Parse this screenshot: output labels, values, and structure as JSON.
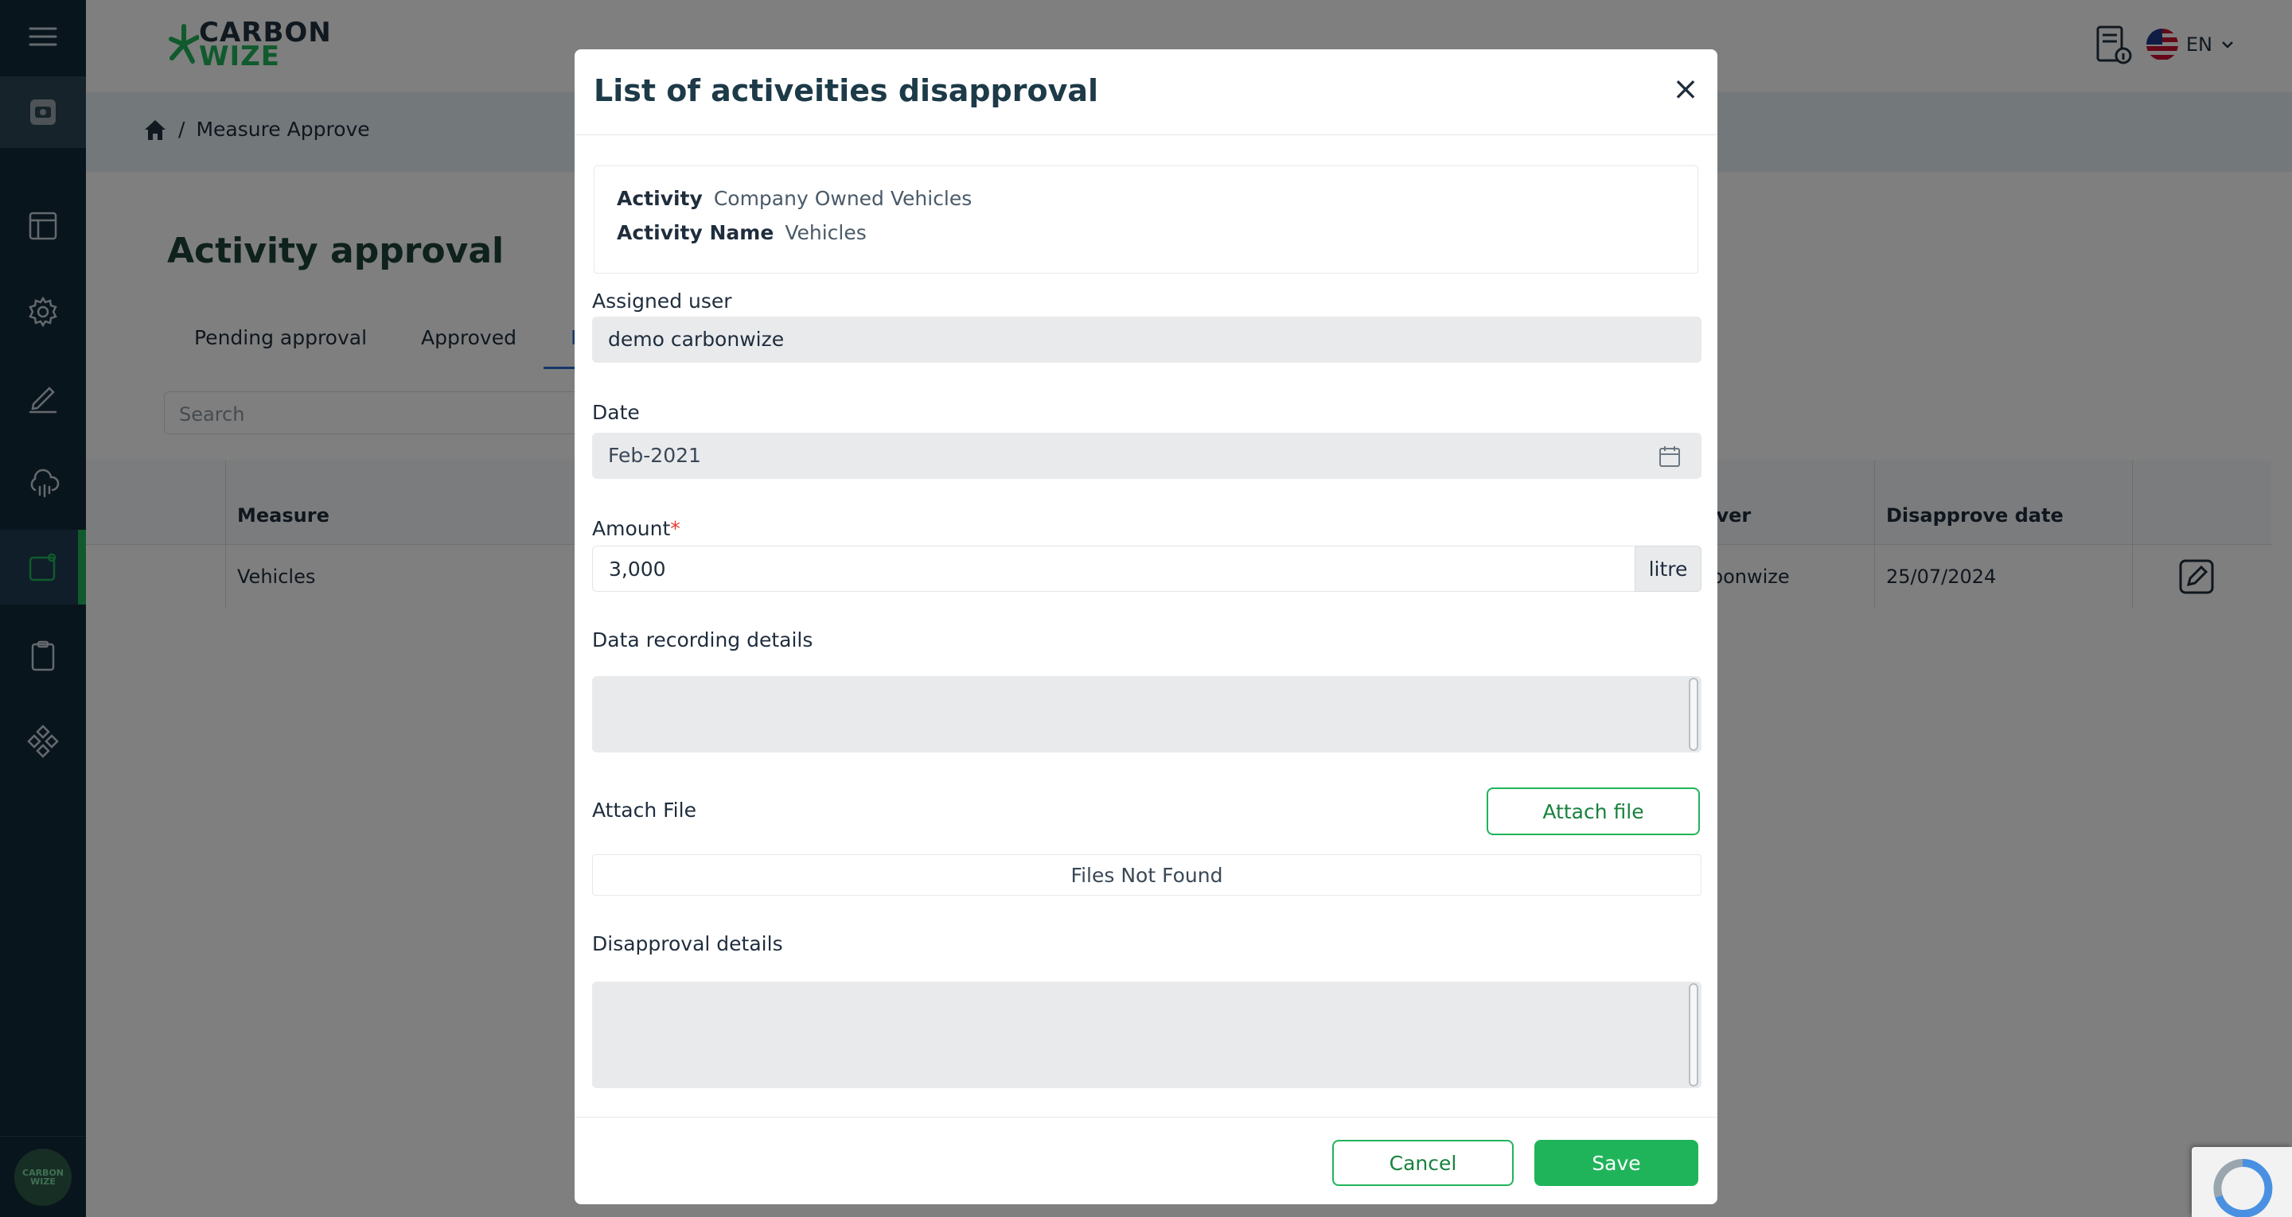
{
  "app": {
    "logo_line1": "CARBON",
    "logo_line2": "WIZE",
    "language": "EN",
    "avatar_text": "CARBON WIZE"
  },
  "breadcrumb": {
    "current": "Measure Approve"
  },
  "page": {
    "title": "Activity approval",
    "tabs": [
      "Pending approval",
      "Approved",
      "Re"
    ],
    "search_placeholder": "Search"
  },
  "table": {
    "headers": {
      "measure": "Measure",
      "approver": "over",
      "disapprove_date": "Disapprove date"
    },
    "row": {
      "measure": "Vehicles",
      "approver": "rbonwize",
      "disapprove_date": "25/07/2024"
    }
  },
  "sidebar": {
    "icons": [
      "menu-icon",
      "camera-icon",
      "layout-icon",
      "gear-icon",
      "pen-icon",
      "cloud-icon",
      "activity-icon",
      "clipboard-icon",
      "diamond-grid-icon"
    ]
  },
  "modal": {
    "title": "List of activeities disapproval",
    "close_symbol": "×",
    "activity_label": "Activity",
    "activity_value": "Company Owned Vehicles",
    "activity_name_label": "Activity Name",
    "activity_name_value": "Vehicles",
    "assigned_user_label": "Assigned user",
    "assigned_user_value": "demo carbonwize",
    "date_label": "Date",
    "date_value": "Feb-2021",
    "amount_label": "Amount",
    "amount_required": "*",
    "amount_value": "3,000",
    "amount_unit": "litre",
    "data_recording_label": "Data recording details",
    "data_recording_value": "",
    "attach_file_label": "Attach File",
    "attach_file_button": "Attach file",
    "files_empty": "Files Not Found",
    "disapproval_label": "Disapproval details",
    "disapproval_value": "",
    "cancel_button": "Cancel",
    "save_button": "Save"
  },
  "colors": {
    "brand_green": "#20b45a",
    "sidebar_bg": "#122a3a",
    "title_dark": "#1d3a48"
  }
}
